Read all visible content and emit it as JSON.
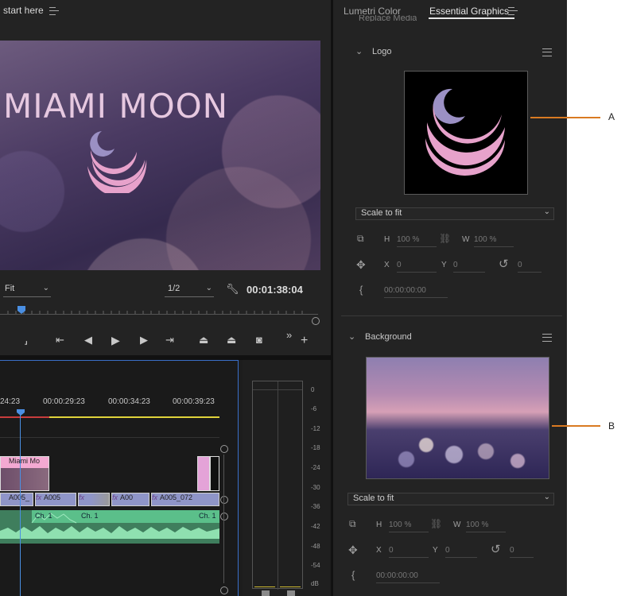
{
  "monitor": {
    "tab_label": "start here",
    "video_title": "MIAMI MOON",
    "fit_select": "Fit",
    "resolution_select": "1/2",
    "timecode": "00:01:38:04"
  },
  "timeline": {
    "ruler": [
      "24:23",
      "00:00:29:23",
      "00:00:34:23",
      "00:00:39:23"
    ],
    "graphic_clip": "Miami Mo",
    "video_clips": [
      "A005_",
      "A005",
      "",
      "A00",
      "A005_072"
    ],
    "audio_labels": [
      "Ch. 1",
      "Ch. 1",
      "Ch. 1"
    ]
  },
  "meter": {
    "scale": [
      "0",
      "-6",
      "-12",
      "-18",
      "-24",
      "-30",
      "-36",
      "-42",
      "-48",
      "-54",
      "dB"
    ]
  },
  "panel": {
    "tabs": [
      "Lumetri Color",
      "Essential Graphics"
    ],
    "active_tab": "Essential Graphics",
    "cut_off_text": "Replace Media",
    "logo": {
      "title": "Logo",
      "scale_select": "Scale to fit",
      "h_label": "H",
      "h_value": "100 %",
      "w_label": "W",
      "w_value": "100 %",
      "x_label": "X",
      "x_value": "0",
      "y_label": "Y",
      "y_value": "0",
      "rotation_value": "0",
      "time_value": "00:00:00:00"
    },
    "background": {
      "title": "Background",
      "scale_select": "Scale to fit",
      "h_label": "H",
      "h_value": "100 %",
      "w_label": "W",
      "w_value": "100 %",
      "x_label": "X",
      "x_value": "0",
      "y_label": "Y",
      "y_value": "0",
      "rotation_value": "0",
      "time_value": "00:00:00:00"
    }
  },
  "callouts": [
    "A",
    "B"
  ],
  "colors": {
    "accent_blue": "#3a6fc9",
    "callout_orange": "#d97a22",
    "logo_pink": "#e7a2cb",
    "audio_green": "#5bbf8a",
    "clip_violet": "#8f95c8",
    "graphic_pink": "#e4a3d8"
  }
}
